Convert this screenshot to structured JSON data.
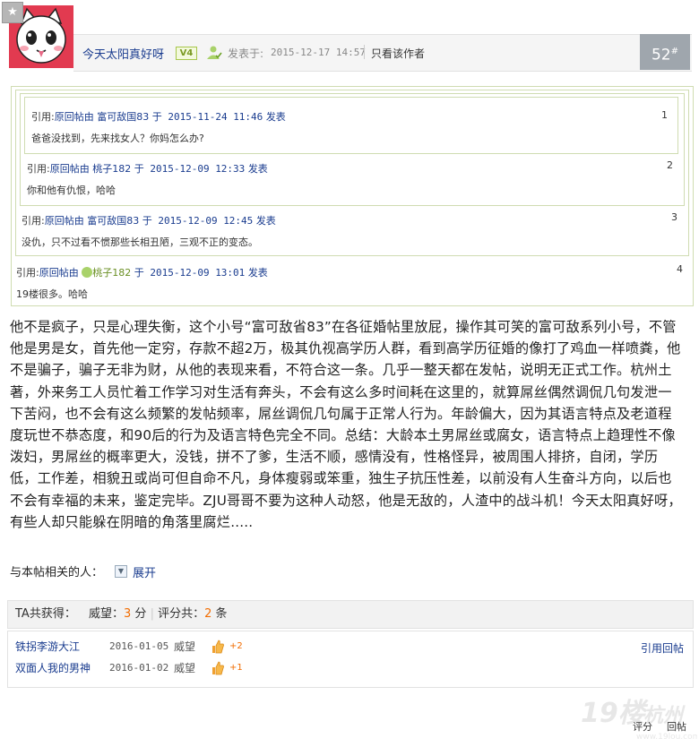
{
  "header": {
    "username": "今天太阳真好呀",
    "level": "V4",
    "posted_label": "发表于:",
    "post_time": "2015-12-17 14:57",
    "author_only": "只看该作者",
    "floor_number": "52",
    "floor_mark": "#"
  },
  "quotes": [
    {
      "prefix": "引用:",
      "source": "原回帖由",
      "user": "富可敌国83",
      "time": "于 2015-11-24 11:46",
      "action": "发表",
      "text": "爸爸没找到，先来找女人？你妈怎么办?",
      "num": "1"
    },
    {
      "prefix": "引用:",
      "source": "原回帖由",
      "user": "桃子182",
      "time": "于 2015-12-09 12:33",
      "action": "发表",
      "text": "你和他有仇恨，哈哈",
      "num": "2"
    },
    {
      "prefix": "引用:",
      "source": "原回帖由",
      "user": "富可敌国83",
      "time": "于 2015-12-09 12:45",
      "action": "发表",
      "text": "没仇，只不过看不惯那些长相丑陋，三观不正的变态。",
      "num": "3"
    },
    {
      "prefix": "引用:",
      "source": "原回帖由",
      "user": "桃子182",
      "time": "于 2015-12-09 13:01",
      "action": "发表",
      "text": "19楼很多。哈哈",
      "num": "4"
    }
  ],
  "body": {
    "text": "他不是疯子，只是心理失衡，这个小号“富可敌省83”在各征婚帖里放屁，操作其可笑的富可敌系列小号，不管他是男是女，首先他一定穷，存款不超2万，极其仇视高学历人群，看到高学历征婚的像打了鸡血一样喷粪，他不是骗子，骗子无非为财，从他的表现来看，不符合这一条。几乎一整天都在发帖，说明无正式工作。杭州土著，外来务工人员忙着工作学习对生活有奔头，不会有这么多时间耗在这里的，就算屌丝偶然调侃几句发泄一下苦闷，也不会有这么频繁的发帖频率，屌丝调侃几句属于正常人行为。年龄偏大，因为其语言特点及老道程度玩世不恭态度，和90后的行为及语言特色完全不同。总结：大龄本土男屌丝或腐女，语言特点上趋理性不像泼妇，男屌丝的概率更大，没钱，拼不了爹，生活不顺，感情没有，性格怪异，被周围人排挤，自闭，学历低，工作差，相貌丑或尚可但自命不凡，身体瘦弱或笨重，独生子抗压性差，以前没有人生奋斗方向，以后也不会有幸福的未来，鉴定完毕。ZJU哥哥不要为这种人动怒，他是无敌的，人渣中的战斗机！今天太阳真好呀，有些人却只能躲在阴暗的角落里腐烂....."
  },
  "related": {
    "label": "与本帖相关的人：",
    "expand": "展开"
  },
  "rating": {
    "summary_label": "TA共获得：",
    "prestige_label": "威望：",
    "prestige_value": "3",
    "prestige_unit": "分",
    "rate_count_label": "评分共：",
    "rate_count_value": "2",
    "rate_count_unit": "条",
    "quote_reply": "引用回帖",
    "entries": [
      {
        "user": "铁拐李游大江",
        "date": "2016-01-05",
        "type": "威望",
        "value": "+2"
      },
      {
        "user": "双面人我的男神",
        "date": "2016-01-02",
        "type": "威望",
        "value": "+1"
      }
    ]
  },
  "footer": {
    "rate_btn": "评分",
    "reply_btn": "回帖"
  }
}
